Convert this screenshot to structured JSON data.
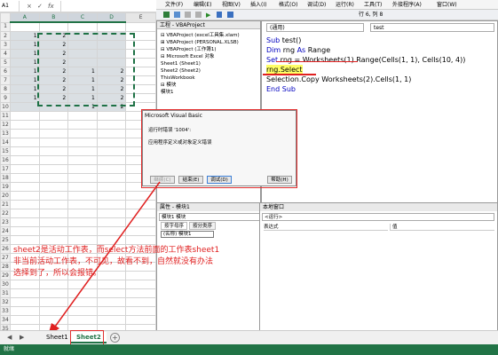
{
  "excel": {
    "name_box": "A1",
    "formula_bar_buttons": [
      "×",
      "✓",
      "fx"
    ],
    "column_headers": [
      "A",
      "B",
      "C",
      "D",
      "E"
    ],
    "rows": [
      {
        "n": "1",
        "cells": [
          "",
          "",
          "",
          "",
          ""
        ]
      },
      {
        "n": "2",
        "cells": [
          "1",
          "2",
          "",
          "",
          ""
        ]
      },
      {
        "n": "3",
        "cells": [
          "1",
          "2",
          "",
          "",
          ""
        ]
      },
      {
        "n": "4",
        "cells": [
          "1",
          "2",
          "",
          "",
          ""
        ]
      },
      {
        "n": "5",
        "cells": [
          "1",
          "2",
          "",
          "",
          ""
        ]
      },
      {
        "n": "6",
        "cells": [
          "1",
          "2",
          "1",
          "2",
          ""
        ]
      },
      {
        "n": "7",
        "cells": [
          "1",
          "2",
          "1",
          "2",
          ""
        ]
      },
      {
        "n": "8",
        "cells": [
          "1",
          "2",
          "1",
          "2",
          ""
        ]
      },
      {
        "n": "9",
        "cells": [
          "1",
          "2",
          "1",
          "2",
          ""
        ]
      },
      {
        "n": "10",
        "cells": [
          "",
          "",
          "1",
          "2",
          ""
        ]
      },
      {
        "n": "11",
        "cells": [
          "",
          "",
          "",
          "",
          ""
        ]
      },
      {
        "n": "12",
        "cells": [
          "",
          "",
          "",
          "",
          ""
        ]
      },
      {
        "n": "13",
        "cells": [
          "",
          "",
          "",
          "",
          ""
        ]
      },
      {
        "n": "14",
        "cells": [
          "",
          "",
          "",
          "",
          ""
        ]
      },
      {
        "n": "15",
        "cells": [
          "",
          "",
          "",
          "",
          ""
        ]
      },
      {
        "n": "16",
        "cells": [
          "",
          "",
          "",
          "",
          ""
        ]
      },
      {
        "n": "17",
        "cells": [
          "",
          "",
          "",
          "",
          ""
        ]
      },
      {
        "n": "18",
        "cells": [
          "",
          "",
          "",
          "",
          ""
        ]
      },
      {
        "n": "19",
        "cells": [
          "",
          "",
          "",
          "",
          ""
        ]
      },
      {
        "n": "20",
        "cells": [
          "",
          "",
          "",
          "",
          ""
        ]
      },
      {
        "n": "21",
        "cells": [
          "",
          "",
          "",
          "",
          ""
        ]
      },
      {
        "n": "22",
        "cells": [
          "",
          "",
          "",
          "",
          ""
        ]
      },
      {
        "n": "23",
        "cells": [
          "",
          "",
          "",
          "",
          ""
        ]
      },
      {
        "n": "24",
        "cells": [
          "",
          "",
          "",
          "",
          ""
        ]
      },
      {
        "n": "25",
        "cells": [
          "",
          "",
          "",
          "",
          ""
        ]
      },
      {
        "n": "26",
        "cells": [
          "",
          "",
          "",
          "",
          ""
        ]
      },
      {
        "n": "27",
        "cells": [
          "",
          "",
          "",
          "",
          ""
        ]
      },
      {
        "n": "28",
        "cells": [
          "",
          "",
          "",
          "",
          ""
        ]
      },
      {
        "n": "29",
        "cells": [
          "",
          "",
          "",
          "",
          ""
        ]
      },
      {
        "n": "30",
        "cells": [
          "",
          "",
          "",
          "",
          ""
        ]
      },
      {
        "n": "31",
        "cells": [
          "",
          "",
          "",
          "",
          ""
        ]
      },
      {
        "n": "32",
        "cells": [
          "",
          "",
          "",
          "",
          ""
        ]
      },
      {
        "n": "33",
        "cells": [
          "",
          "",
          "",
          "",
          ""
        ]
      },
      {
        "n": "34",
        "cells": [
          "",
          "",
          "",
          "",
          ""
        ]
      },
      {
        "n": "35",
        "cells": [
          "",
          "",
          "",
          "",
          ""
        ]
      }
    ],
    "sheet_tabs": [
      "Sheet1",
      "Sheet2"
    ],
    "tab_nav": [
      "◀",
      "▶"
    ],
    "add_sheet": "+",
    "status": "就绪"
  },
  "vbe": {
    "menus": [
      "文件(F)",
      "编辑(E)",
      "视图(V)",
      "插入(I)",
      "格式(O)",
      "调试(D)",
      "运行(R)",
      "工具(T)",
      "外接程序(A)",
      "窗口(W)"
    ],
    "toolbar_position": "行 6, 列 8",
    "project_title": "工程 - VBAProject",
    "tree": [
      "⊟ VBAProject (excel工具集.xlam)",
      "⊞ VBAProject (PERSONAL.XLSB)",
      "⊟ VBAProject (工作簿1)",
      "  ⊟ Microsoft Excel 对象",
      "      Sheet1 (Sheet1)",
      "      Sheet2 (Sheet2)",
      "      ThisWorkbook",
      "  ⊟ 模块",
      "      模块1"
    ],
    "code_dropdown_left": "(通用)",
    "code_dropdown_right": "test",
    "code": {
      "line1_kw": "Sub",
      "line1_rest": " test()",
      "line2_kw1": "Dim",
      "line2_mid": " rng ",
      "line2_kw2": "As",
      "line2_rest": " Range",
      "line3_kw": "Set",
      "line3_rest": " rng = Worksheets(1).Range(Cells(1, 1), Cells(10, 4))",
      "line4": "rng.Select",
      "line5": "Selection.Copy Worksheets(2).Cells(1, 1)",
      "line6": "End Sub"
    },
    "dialog": {
      "title": "Microsoft Visual Basic",
      "error": "运行时错误 '1004':",
      "message": "应用程序定义或对象定义错误",
      "buttons": [
        "继续(C)",
        "结束(E)",
        "调试(D)",
        "帮助(H)"
      ]
    },
    "props": {
      "title": "属性 - 模块1",
      "dropdown": "模块1 模块",
      "tabs": [
        "按字母序",
        "按分类序"
      ],
      "row": "(名称) 模块1"
    },
    "immediate": {
      "title": "本地窗口",
      "dropdown": "<运行>",
      "headers": [
        "表达式",
        "值"
      ]
    }
  },
  "annotation": {
    "line1": "sheet2是活动工作表，而select方法前面的工作表sheet1",
    "line2": "非当前活动工作表，不可见，故看不到，自然就没有办法",
    "line3": "选择到了，所以会报错。"
  },
  "colors": {
    "excel_green": "#217346",
    "annotation_red": "#e02020",
    "keyword_blue": "#0000c0"
  }
}
